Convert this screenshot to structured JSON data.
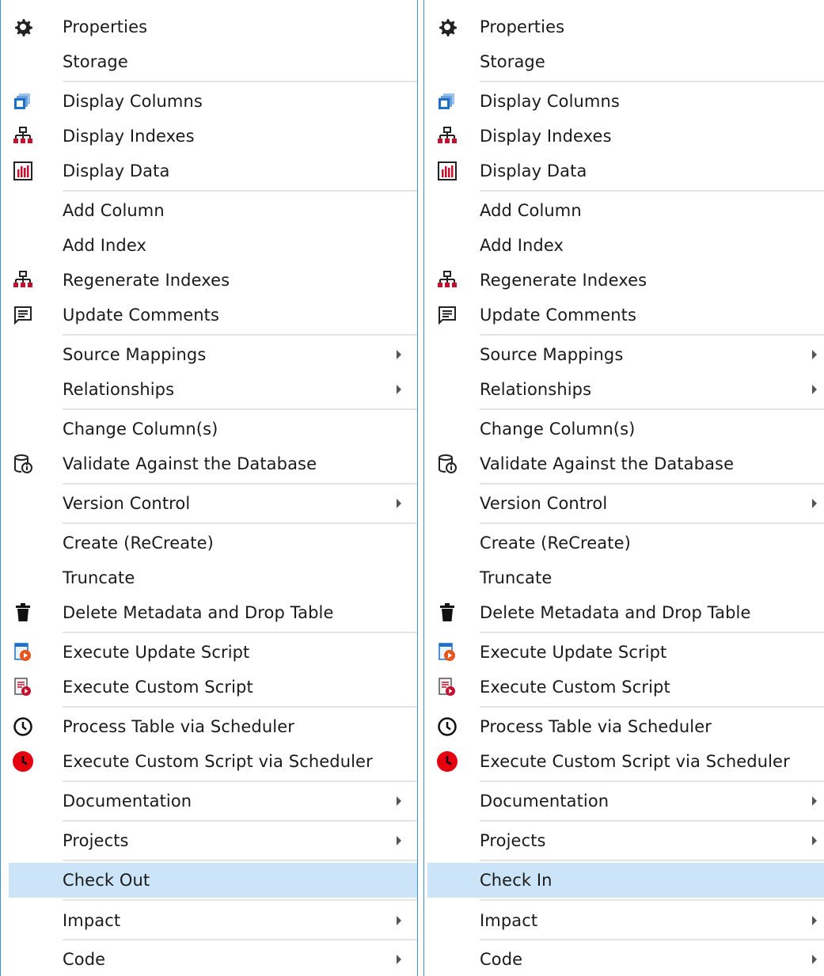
{
  "menus": [
    {
      "id": "left",
      "items": [
        {
          "label": "Properties",
          "icon": "gear-icon"
        },
        {
          "label": "Storage",
          "icon": ""
        },
        {
          "label": "Display Columns",
          "icon": "columns-icon"
        },
        {
          "label": "Display Indexes",
          "icon": "index-hierarchy-icon"
        },
        {
          "label": "Display Data",
          "icon": "data-bar-chart-icon"
        },
        {
          "label": "Add Column",
          "icon": ""
        },
        {
          "label": "Add Index",
          "icon": ""
        },
        {
          "label": "Regenerate Indexes",
          "icon": "index-hierarchy-icon"
        },
        {
          "label": "Update Comments",
          "icon": "comment-icon"
        },
        {
          "label": "Source Mappings",
          "icon": "",
          "submenu": true
        },
        {
          "label": "Relationships",
          "icon": "",
          "submenu": true
        },
        {
          "label": "Change Column(s)",
          "icon": ""
        },
        {
          "label": "Validate Against the Database",
          "icon": "database-validate-icon"
        },
        {
          "label": "Version Control",
          "icon": "",
          "submenu": true
        },
        {
          "label": "Create (ReCreate)",
          "icon": ""
        },
        {
          "label": "Truncate",
          "icon": ""
        },
        {
          "label": "Delete Metadata and Drop Table",
          "icon": "trash-icon"
        },
        {
          "label": "Execute Update Script",
          "icon": "execute-update-script-icon"
        },
        {
          "label": "Execute Custom Script",
          "icon": "execute-custom-script-icon"
        },
        {
          "label": "Process Table via Scheduler",
          "icon": "clock-icon"
        },
        {
          "label": "Execute Custom Script via Scheduler",
          "icon": "red-clock-icon"
        },
        {
          "label": "Documentation",
          "icon": "",
          "submenu": true
        },
        {
          "label": "Projects",
          "icon": "",
          "submenu": true
        },
        {
          "label": "Check Out",
          "icon": "",
          "highlighted": true
        },
        {
          "label": "Impact",
          "icon": "",
          "submenu": true
        },
        {
          "label": "Code",
          "icon": "",
          "submenu": true
        }
      ]
    },
    {
      "id": "right",
      "items": [
        {
          "label": "Properties",
          "icon": "gear-icon"
        },
        {
          "label": "Storage",
          "icon": ""
        },
        {
          "label": "Display Columns",
          "icon": "columns-icon"
        },
        {
          "label": "Display Indexes",
          "icon": "index-hierarchy-icon"
        },
        {
          "label": "Display Data",
          "icon": "data-bar-chart-icon"
        },
        {
          "label": "Add Column",
          "icon": ""
        },
        {
          "label": "Add Index",
          "icon": ""
        },
        {
          "label": "Regenerate Indexes",
          "icon": "index-hierarchy-icon"
        },
        {
          "label": "Update Comments",
          "icon": "comment-icon"
        },
        {
          "label": "Source Mappings",
          "icon": "",
          "submenu": true
        },
        {
          "label": "Relationships",
          "icon": "",
          "submenu": true
        },
        {
          "label": "Change Column(s)",
          "icon": ""
        },
        {
          "label": "Validate Against the Database",
          "icon": "database-validate-icon"
        },
        {
          "label": "Version Control",
          "icon": "",
          "submenu": true
        },
        {
          "label": "Create (ReCreate)",
          "icon": ""
        },
        {
          "label": "Truncate",
          "icon": ""
        },
        {
          "label": "Delete Metadata and Drop Table",
          "icon": "trash-icon"
        },
        {
          "label": "Execute Update Script",
          "icon": "execute-update-script-icon"
        },
        {
          "label": "Execute Custom Script",
          "icon": "execute-custom-script-icon"
        },
        {
          "label": "Process Table via Scheduler",
          "icon": "clock-icon"
        },
        {
          "label": "Execute Custom Script via Scheduler",
          "icon": "red-clock-icon"
        },
        {
          "label": "Documentation",
          "icon": "",
          "submenu": true
        },
        {
          "label": "Projects",
          "icon": "",
          "submenu": true
        },
        {
          "label": "Check In",
          "icon": "",
          "highlighted": true
        },
        {
          "label": "Impact",
          "icon": "",
          "submenu": true
        },
        {
          "label": "Code",
          "icon": "",
          "submenu": true
        }
      ]
    }
  ],
  "colors": {
    "border": "#3b8ed8",
    "highlight": "#cce4f7",
    "separator": "#e4e4e4",
    "icon_blue": "#1e6fc9",
    "icon_red": "#c8102e",
    "icon_orange": "#e8541b",
    "icon_dark": "#222222"
  }
}
